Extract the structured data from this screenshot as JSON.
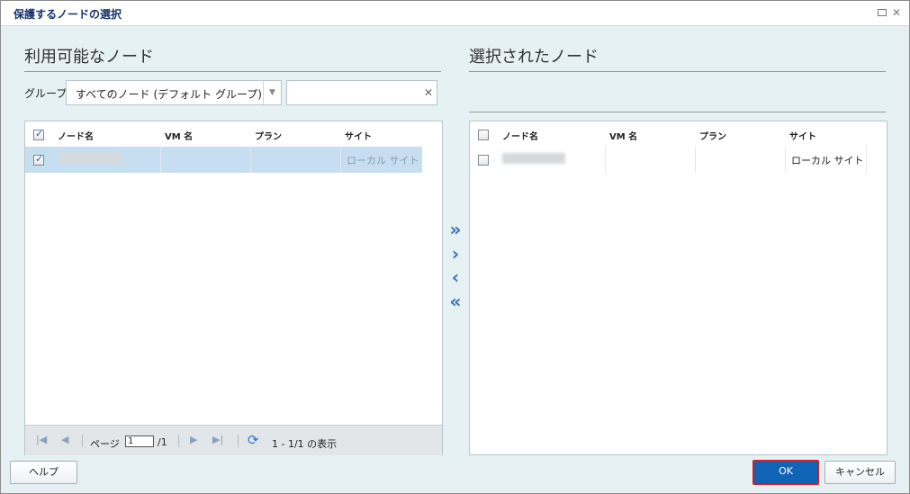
{
  "dialog": {
    "title": "保護するノードの選択"
  },
  "available": {
    "heading": "利用可能なノード",
    "group_label": "グループ",
    "group_value": "すべてのノード (デフォルト グループ)",
    "search_value": "",
    "columns": [
      "ノード名",
      "VM 名",
      "プラン",
      "サイト"
    ],
    "header_checked": true,
    "rows": [
      {
        "checked": true,
        "node": "",
        "vm": "",
        "plan": "",
        "site": "ローカル サイト"
      }
    ],
    "pager": {
      "page_label": "ページ",
      "page_value": "1",
      "page_total": "/1",
      "summary": "1 - 1/1 の表示"
    }
  },
  "selected": {
    "heading": "選択されたノード",
    "columns": [
      "ノード名",
      "VM 名",
      "プラン",
      "サイト"
    ],
    "header_checked": false,
    "rows": [
      {
        "checked": false,
        "node": "",
        "vm": "",
        "plan": "",
        "site": "ローカル サイト"
      }
    ]
  },
  "move_buttons": {
    "add_all": "»",
    "add": "›",
    "remove": "‹",
    "remove_all": "«"
  },
  "footer": {
    "help_label": "ヘルプ",
    "ok_label": "OK",
    "cancel_label": "キャンセル"
  },
  "colors": {
    "title": "#15326a",
    "background": "#e6f0f3",
    "selected_row": "#c6dff0",
    "ok_button": "#1163b5",
    "ok_border": "#d0202a"
  }
}
